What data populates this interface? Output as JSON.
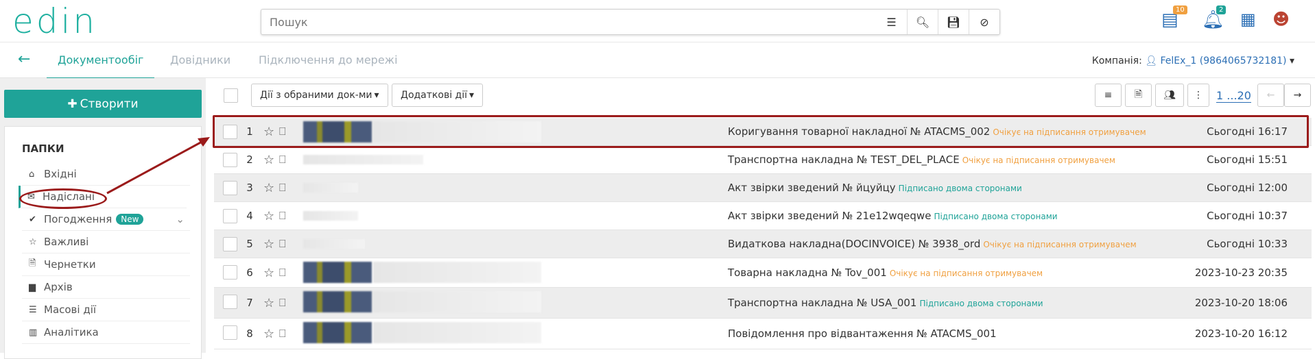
{
  "logo": "edin",
  "search": {
    "placeholder": "Пошук",
    "icons": [
      "sliders-icon",
      "search-icon",
      "save-icon",
      "clear-icon"
    ]
  },
  "header": {
    "badge_docs": "10",
    "badge_bell": "2",
    "colors": {
      "accent": "#1fa398",
      "link": "#2c6fb5",
      "badge_orange": "#f0a040",
      "badge_green": "#1fa398"
    }
  },
  "nav": {
    "back_icon": "arrow-left-icon",
    "tabs": [
      "Документообіг",
      "Довідники",
      "Підключення до мережі"
    ],
    "company_label": "Компанія:",
    "company_value": "FelEx_1 (9864065732181)"
  },
  "sidebar": {
    "create_label": "Створити",
    "folders_title": "ПАПКИ",
    "items": [
      {
        "label": "Вхідні",
        "icon": "inbox-icon"
      },
      {
        "label": "Надіслані",
        "icon": "envelope-icon"
      },
      {
        "label": "Погодження",
        "icon": "check-icon",
        "badge": "New"
      },
      {
        "label": "Важливі",
        "icon": "star-icon"
      },
      {
        "label": "Чернетки",
        "icon": "draft-icon"
      },
      {
        "label": "Архів",
        "icon": "archive-icon"
      },
      {
        "label": "Масові дії",
        "icon": "list-icon"
      },
      {
        "label": "Аналітика",
        "icon": "chart-icon"
      }
    ]
  },
  "toolbar": {
    "selected_actions": "Дії з обраними док-ми",
    "extra_actions": "Додаткові дії",
    "pagination": "1 ...20"
  },
  "rows": [
    {
      "n": "1",
      "doc": "Коригування товарної накладної № ATACMS_002",
      "status": "Очікує на підписання отримувачем",
      "status_type": "wait",
      "date": "Сьогодні 16:17"
    },
    {
      "n": "2",
      "doc": "Транспортна накладна № TEST_DEL_PLACE",
      "status": "Очікує на підписання отримувачем",
      "status_type": "wait",
      "date": "Сьогодні 15:51"
    },
    {
      "n": "3",
      "doc": "Акт звірки зведений № йцуйцу",
      "status": "Підписано двома сторонами",
      "status_type": "ok",
      "date": "Сьогодні 12:00"
    },
    {
      "n": "4",
      "doc": "Акт звірки зведений № 21e12wqeqwe",
      "status": "Підписано двома сторонами",
      "status_type": "ok",
      "date": "Сьогодні 10:37"
    },
    {
      "n": "5",
      "doc": "Видаткова накладна(DOCINVOICE) № 3938_ord",
      "status": "Очікує на підписання отримувачем",
      "status_type": "wait",
      "date": "Сьогодні 10:33"
    },
    {
      "n": "6",
      "doc": "Товарна накладна № Tov_001",
      "status": "Очікує на підписання отримувачем",
      "status_type": "wait",
      "date": "2023-10-23 20:35"
    },
    {
      "n": "7",
      "doc": "Транспортна накладна № USA_001",
      "status": "Підписано двома сторонами",
      "status_type": "ok",
      "date": "2023-10-20 18:06"
    },
    {
      "n": "8",
      "doc": "Повідомлення про відвантаження № ATACMS_001",
      "status": "",
      "status_type": "none",
      "date": "2023-10-20 16:12"
    }
  ]
}
